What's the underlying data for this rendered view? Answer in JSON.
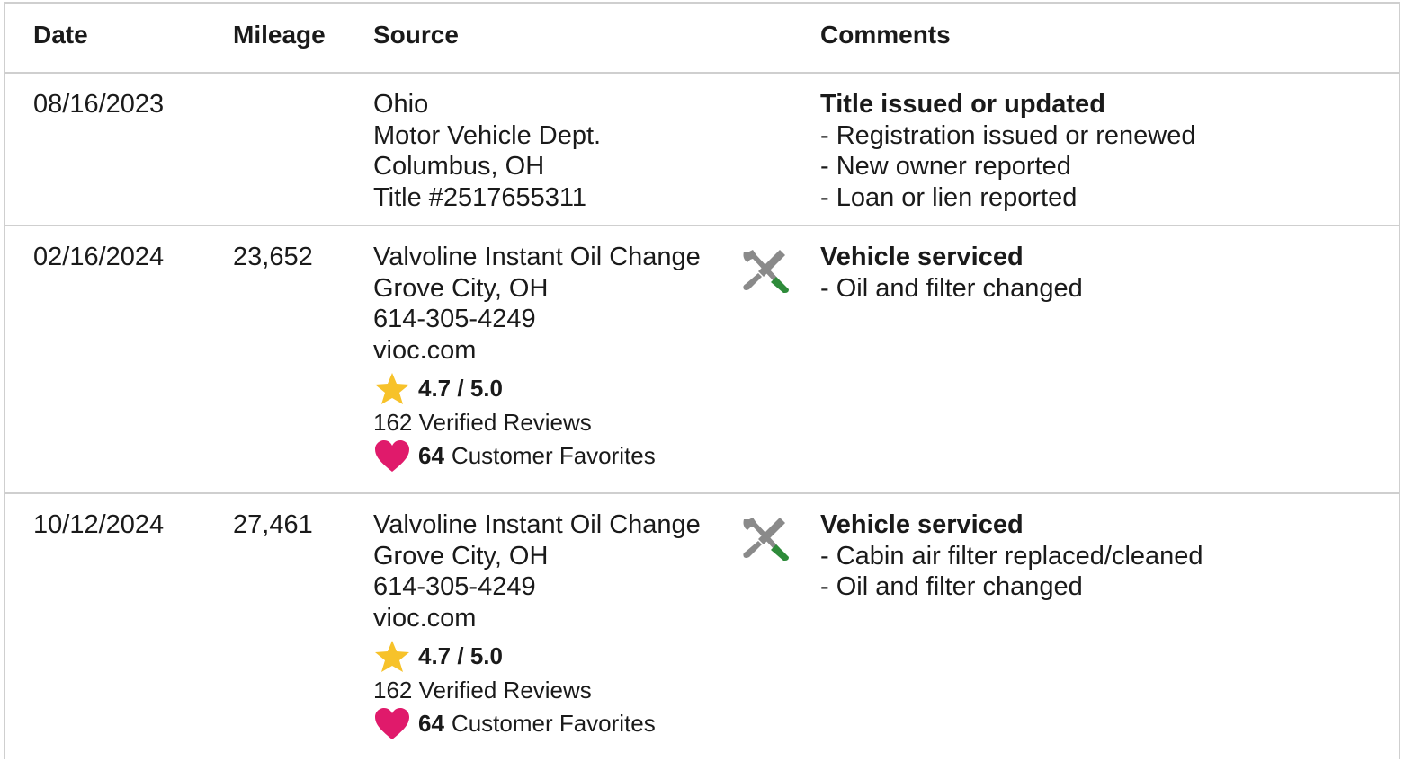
{
  "columns": {
    "date": "Date",
    "mileage": "Mileage",
    "source": "Source",
    "comments": "Comments"
  },
  "icons": {
    "service": "wrench-screwdriver-icon",
    "rating": "star-icon",
    "favorites": "heart-icon"
  },
  "colors": {
    "star": "#f7c22a",
    "heart": "#e01a6b",
    "tool_gray": "#8a8a8a",
    "tool_green": "#2e8b3a",
    "border": "#cfcfcf"
  },
  "records": [
    {
      "date": "08/16/2023",
      "mileage": "",
      "source": {
        "lines": [
          "Ohio",
          "Motor Vehicle Dept.",
          "Columbus, OH",
          "Title #2517655311"
        ]
      },
      "comments": {
        "title": "Title issued or updated",
        "items": [
          "- Registration issued or renewed",
          "- New owner reported",
          "- Loan or lien reported"
        ]
      }
    },
    {
      "date": "02/16/2024",
      "mileage": "23,652",
      "source": {
        "lines": [
          "Valvoline Instant Oil Change",
          "Grove City, OH",
          "614-305-4249",
          "vioc.com"
        ],
        "rating": "4.7 / 5.0",
        "reviews": "162 Verified Reviews",
        "favorites_count": "64",
        "favorites_label": "Customer Favorites"
      },
      "comments": {
        "title": "Vehicle serviced",
        "items": [
          "- Oil and filter changed"
        ]
      }
    },
    {
      "date": "10/12/2024",
      "mileage": "27,461",
      "source": {
        "lines": [
          "Valvoline Instant Oil Change",
          "Grove City, OH",
          "614-305-4249",
          "vioc.com"
        ],
        "rating": "4.7 / 5.0",
        "reviews": "162 Verified Reviews",
        "favorites_count": "64",
        "favorites_label": "Customer Favorites"
      },
      "comments": {
        "title": "Vehicle serviced",
        "items": [
          "- Cabin air filter replaced/cleaned",
          "- Oil and filter changed"
        ]
      }
    }
  ]
}
